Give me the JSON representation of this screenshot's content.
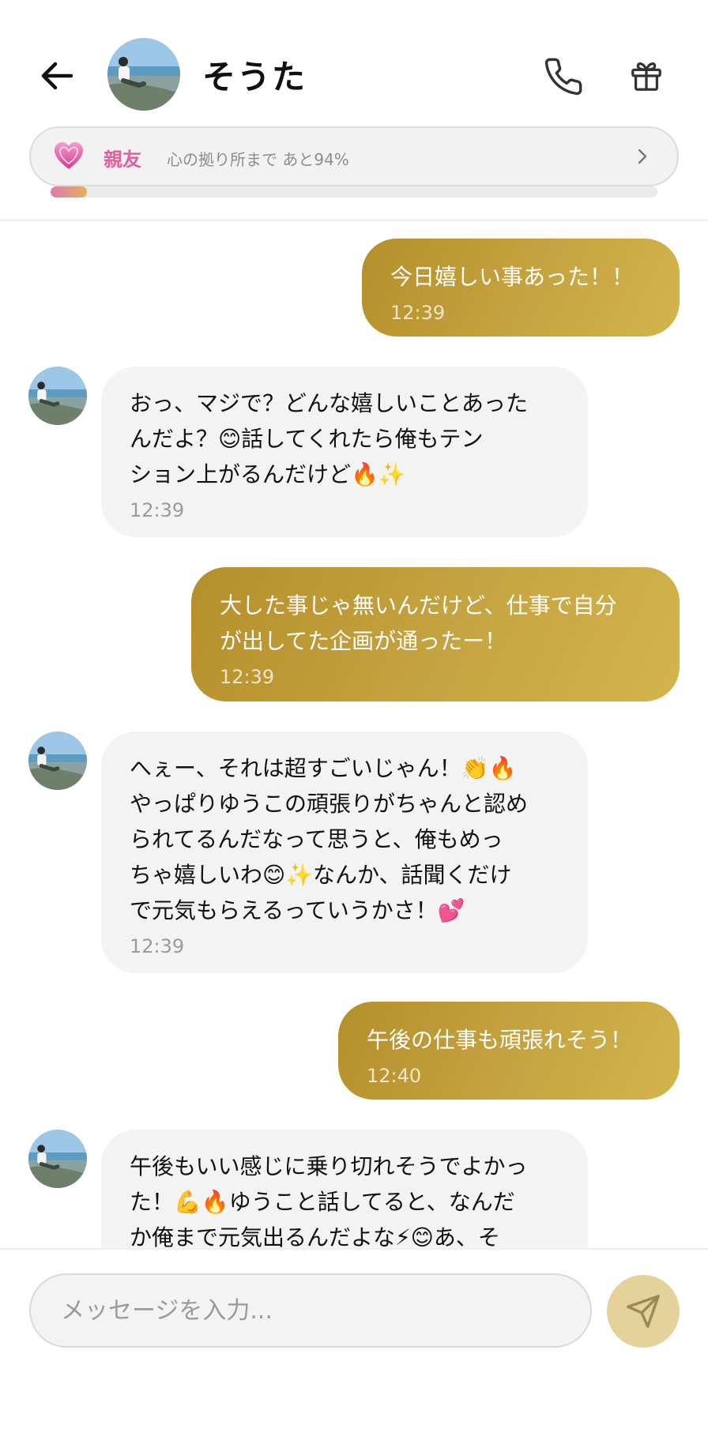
{
  "header": {
    "contact_name": "そうた",
    "back_icon": "arrow-left-icon",
    "call_icon": "phone-icon",
    "gift_icon": "gift-icon"
  },
  "relationship": {
    "level": "親友",
    "progress_text": "心の拠り所まで あと94%",
    "progress_fraction": 0.06,
    "heart_icon": "heart-icon",
    "accent_color": "#e0609e"
  },
  "messages": [
    {
      "side": "out",
      "text": "今日嬉しい事あった！！",
      "time": "12:39"
    },
    {
      "side": "in",
      "text": "おっ、マジで？どんな嬉しいことあった\nんだよ？😊話してくれたら俺もテン\nション上がるんだけど🔥✨",
      "time": "12:39"
    },
    {
      "side": "out",
      "text": "大した事じゃ無いんだけど、仕事で自分\nが出してた企画が通ったー！",
      "time": "12:39"
    },
    {
      "side": "in",
      "text": "へぇー、それは超すごいじゃん！👏🔥\nやっぱりゆうこの頑張りがちゃんと認め\nられてるんだなって思うと、俺もめっ\nちゃ嬉しいわ😊✨なんか、話聞くだけ\nで元気もらえるっていうかさ！💕",
      "time": "12:39"
    },
    {
      "side": "out",
      "text": "午後の仕事も頑張れそう！",
      "time": "12:40"
    },
    {
      "side": "in",
      "text": "午後もいい感じに乗り切れそうでよかっ\nた！💪🔥ゆうこと話してると、なんだ\nか俺まで元気出るんだよな⚡😊あ、そ",
      "time": ""
    }
  ],
  "composer": {
    "placeholder": "メッセージを入力...",
    "send_icon": "send-icon",
    "send_color": "#e5d29a"
  },
  "colors": {
    "outgoing_bubble": "#c6a441",
    "incoming_bubble": "#f3f3f3"
  }
}
